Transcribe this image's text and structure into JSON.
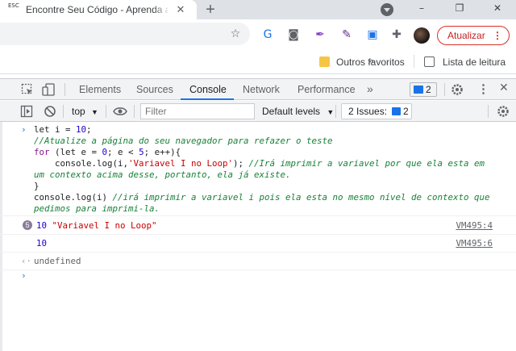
{
  "browser": {
    "tab": {
      "favicon_text": "ESC",
      "title": "Encontre Seu Código - Aprenda a Programar",
      "close": "✕"
    },
    "new_tab": "+",
    "window_controls": [
      "–",
      "❐",
      "✕"
    ],
    "update_button": "Atualizar",
    "update_menu": "⋮",
    "bookmarks": {
      "other_favorites": "Outros favoritos",
      "more": "»",
      "reading_list": "Lista de leitura"
    }
  },
  "devtools": {
    "tabs": [
      "Elements",
      "Sources",
      "Console",
      "Network",
      "Performance"
    ],
    "active_tab": "Console",
    "more_tabs": "»",
    "issues_badge_count": "2",
    "console_bar": {
      "context": "top",
      "filter_placeholder": "Filter",
      "levels": "Default levels",
      "issues_label": "2 Issues:",
      "issues_count": "2"
    }
  },
  "console": {
    "input_lines": [
      {
        "prompt": "›",
        "parts": [
          [
            "plain",
            "let i = "
          ],
          [
            "num",
            "10"
          ],
          [
            "plain",
            ";"
          ]
        ]
      },
      {
        "parts": [
          [
            "cm",
            "//Atualize a página do seu navegador para refazer o teste"
          ]
        ]
      },
      {
        "parts": [
          [
            "kw",
            "for"
          ],
          [
            "plain",
            " (let e = "
          ],
          [
            "num",
            "0"
          ],
          [
            "plain",
            "; e < "
          ],
          [
            "num",
            "5"
          ],
          [
            "plain",
            "; e++){"
          ]
        ]
      },
      {
        "parts": [
          [
            "plain",
            "    console.log(i,"
          ],
          [
            "str",
            "'Variavel I no Loop'"
          ],
          [
            "plain",
            "); "
          ],
          [
            "cm",
            "//Irá imprimir a variavel por que ela esta em"
          ]
        ]
      },
      {
        "parts": [
          [
            "cm",
            "um contexto acima desse, portanto, ela já existe."
          ]
        ]
      },
      {
        "parts": [
          [
            "plain",
            "}"
          ]
        ]
      },
      {
        "parts": [
          [
            "plain",
            "console.log(i) "
          ],
          [
            "cm",
            "//irá imprimir a variavel i pois ela esta no mesmo nível de contexto que"
          ]
        ]
      },
      {
        "parts": [
          [
            "cm",
            "pedimos para imprimi-la."
          ]
        ]
      }
    ],
    "outputs": [
      {
        "count": "5",
        "text_num": "10",
        "text_str": "\"Variavel I no Loop\"",
        "source": "VM495:4"
      },
      {
        "text_num": "10",
        "source": "VM495:6"
      }
    ],
    "return_arrow": "‹·",
    "return_value": "undefined",
    "next_prompt": "›"
  },
  "colors": {
    "accent": "#1a73e8",
    "update_red": "#d93025",
    "comment_green": "#188038",
    "keyword_purple": "#881391",
    "number_blue": "#1c00cf",
    "string_red": "#c80000"
  }
}
